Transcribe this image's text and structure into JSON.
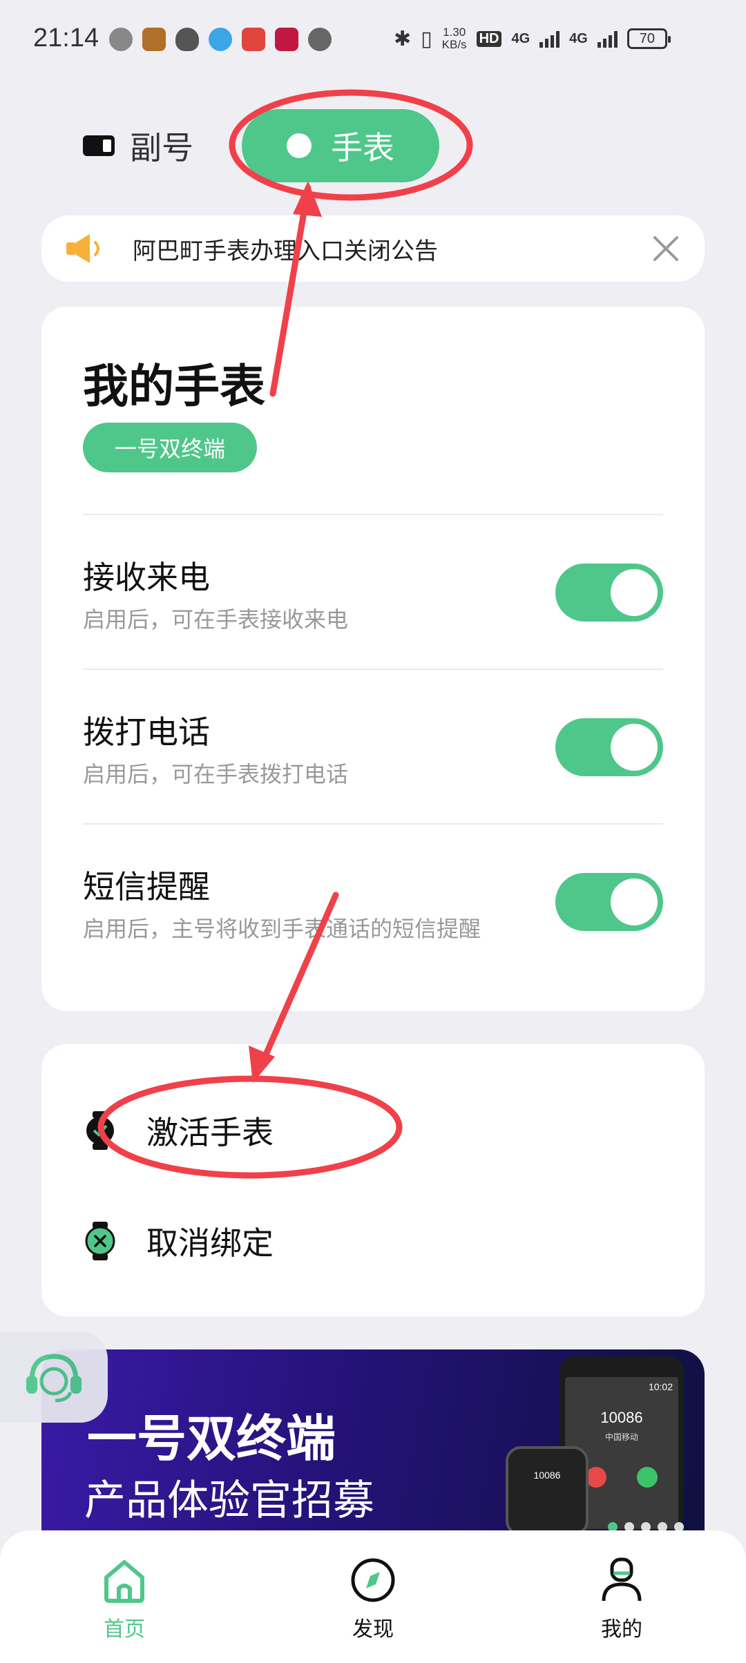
{
  "status_bar": {
    "time": "21:14",
    "net_speed_value": "1.30",
    "net_speed_unit": "KB/s",
    "hd_label": "HD",
    "sim1_label": "4G",
    "sim2_label": "4G",
    "battery": "70"
  },
  "top_tabs": {
    "sub_label": "副号",
    "watch_label": "手表"
  },
  "notice": {
    "text": "阿巴町手表办理入口关闭公告"
  },
  "watch_card": {
    "title": "我的手表",
    "badge": "一号双终端",
    "settings": [
      {
        "title": "接收来电",
        "desc": "启用后，可在手表接收来电",
        "enabled": true
      },
      {
        "title": "拨打电话",
        "desc": "启用后，可在手表拨打电话",
        "enabled": true
      },
      {
        "title": "短信提醒",
        "desc": "启用后，主号将收到手表通话的短信提醒",
        "enabled": true
      }
    ]
  },
  "actions": {
    "activate": "激活手表",
    "unbind": "取消绑定"
  },
  "banner": {
    "headline": "一号双终端",
    "subline": "产品体验官招募",
    "phone_time": "10:02",
    "phone_number": "10086",
    "phone_operator": "中国移动",
    "watch_number": "10086"
  },
  "bottom_nav": {
    "home": "首页",
    "discover": "发现",
    "mine": "我的"
  },
  "colors": {
    "accent": "#4fc68a",
    "annotation": "#f0404a"
  }
}
